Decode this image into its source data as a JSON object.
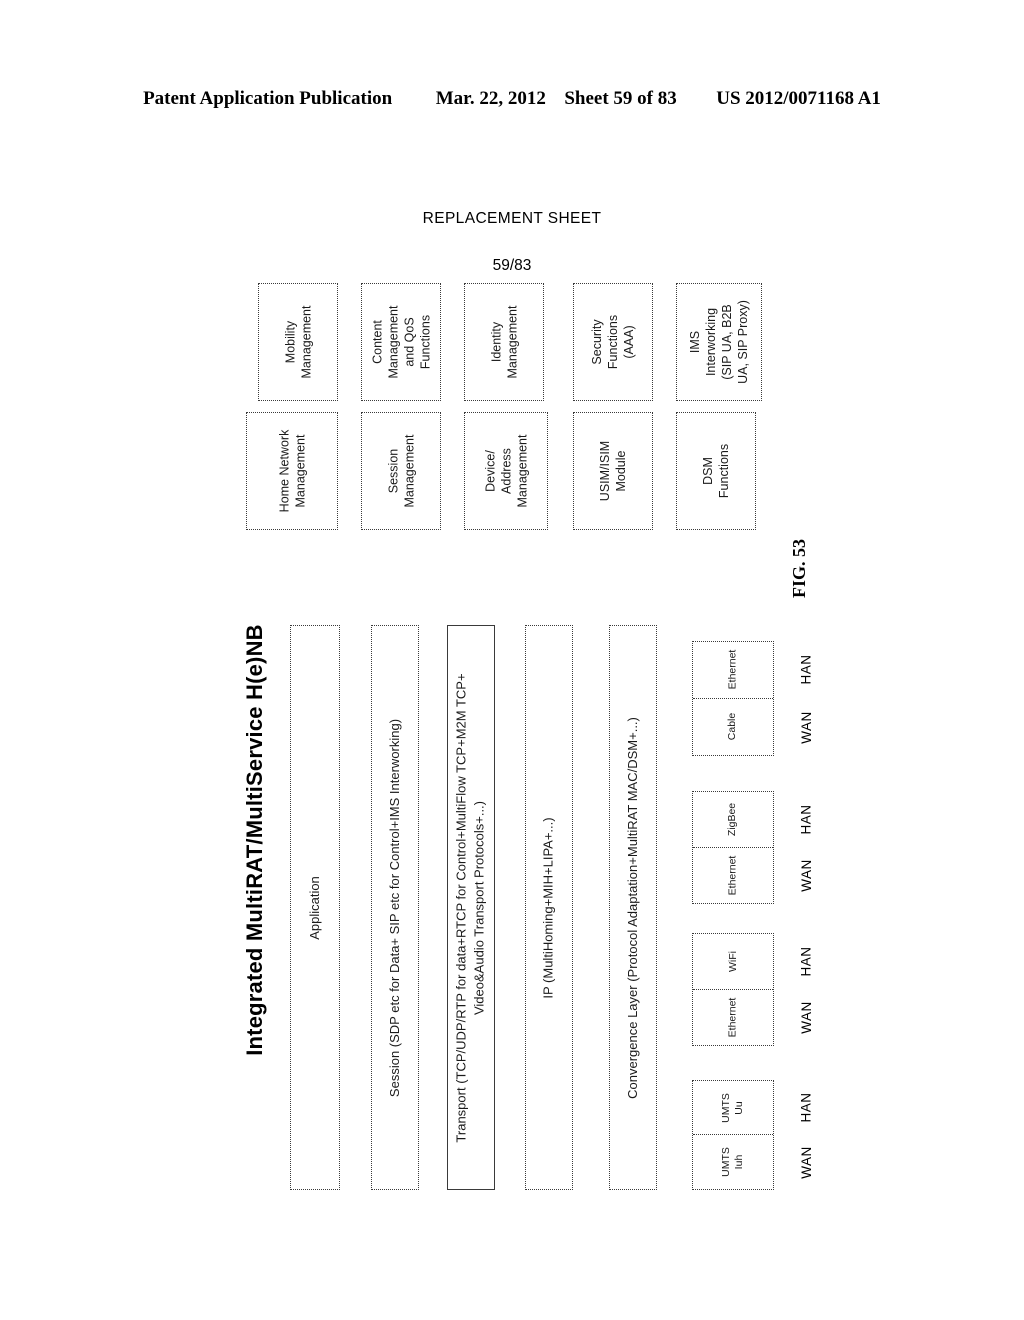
{
  "header": {
    "publication": "Patent Application Publication",
    "date": "Mar. 22, 2012",
    "sheet": "Sheet 59 of 83",
    "patent_number": "US 2012/0071168 A1"
  },
  "sheet_caption": {
    "replacement": "REPLACEMENT SHEET",
    "number": "59/83"
  },
  "figure": {
    "label": "FIG. 53",
    "title": "Integrated MultiRAT/MultiService H(e)NB"
  },
  "function_blocks": {
    "upper_row": [
      {
        "label": "Mobility\nManagement"
      },
      {
        "label": "Content\nManagement\nand QoS\nFunctions"
      },
      {
        "label": "Identity\nManagement"
      },
      {
        "label": "Security\nFunctions\n(AAA)"
      },
      {
        "label": "IMS\nInterworking\n(SIP UA, B2B\nUA, SIP Proxy)"
      }
    ],
    "lower_row": [
      {
        "label": "Home Network\nManagement"
      },
      {
        "label": "Session\nManagement"
      },
      {
        "label": "Device/\nAddress\nManagement"
      },
      {
        "label": "USIM/ISIM\nModule"
      },
      {
        "label": "DSM\nFunctions"
      }
    ]
  },
  "protocol_layers": [
    {
      "name": "application-layer",
      "label": "Application"
    },
    {
      "name": "session-layer",
      "label": "Session (SDP etc for Data+ SIP etc for Control+IMS Interworking)"
    },
    {
      "name": "transport-layer",
      "label": "Transport (TCP/UDP/RTP for data+RTCP for Control+MultiFlow TCP+M2M TCP+\nVideo&Audio Transport Protocols+...)"
    },
    {
      "name": "ip-layer",
      "label": "IP (MultiHoming+MIH+LIPA+...)"
    },
    {
      "name": "convergence-layer",
      "label": "Convergence Layer (Protocol Adaptation+MultiRAT MAC/DSM+...)"
    }
  ],
  "rat_groups": [
    {
      "wan": "UMTS\nIuh",
      "han": "UMTS\nUu",
      "wan_legend": "WAN",
      "han_legend": "HAN"
    },
    {
      "wan": "Ethernet",
      "han": "WiFi",
      "wan_legend": "WAN",
      "han_legend": "HAN"
    },
    {
      "wan": "Ethernet",
      "han": "ZigBee",
      "wan_legend": "WAN",
      "han_legend": "HAN"
    },
    {
      "wan": "Cable",
      "han": "Ethernet",
      "wan_legend": "WAN",
      "han_legend": "HAN"
    }
  ]
}
